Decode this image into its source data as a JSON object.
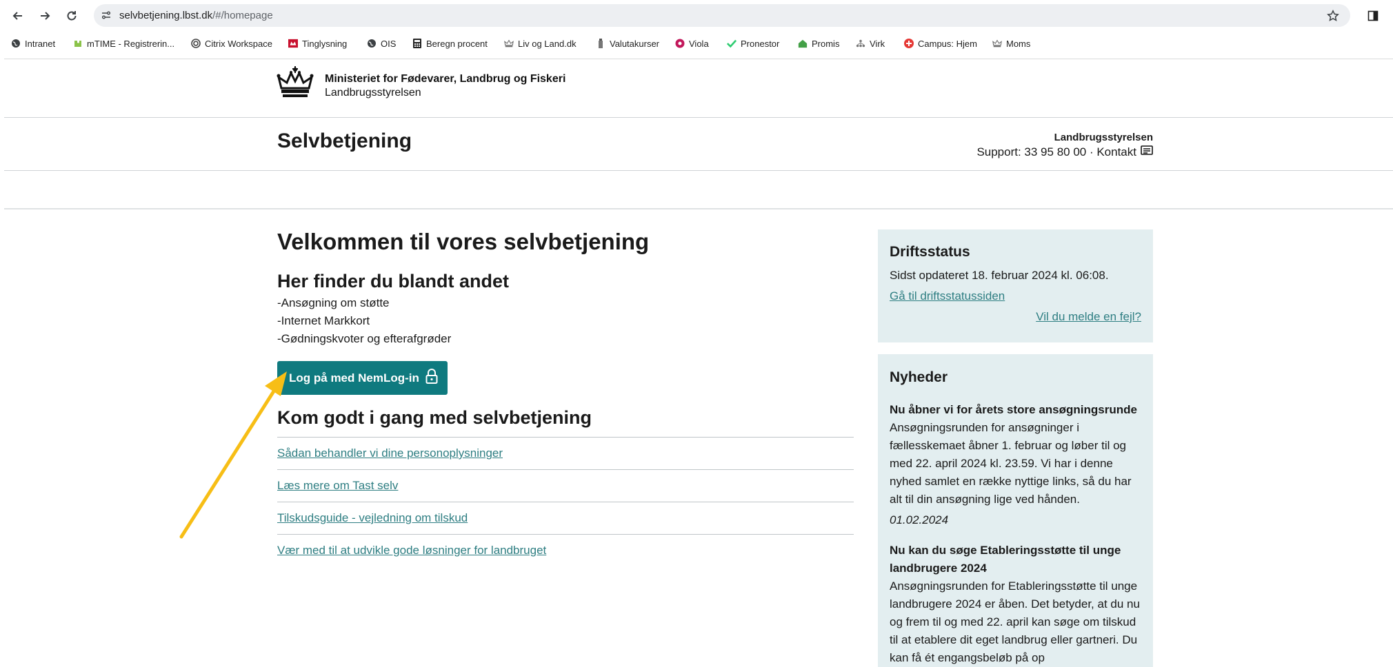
{
  "browser": {
    "url_host": "selvbetjening.lbst.dk",
    "url_path": "/#/homepage",
    "bookmarks": [
      {
        "label": "Intranet",
        "icon": "globe-icon"
      },
      {
        "label": "mTIME - Registrerin...",
        "icon": "puzzle-icon"
      },
      {
        "label": "Citrix Workspace",
        "icon": "citrix-icon"
      },
      {
        "label": "Tinglysning",
        "icon": "tinglysning-icon"
      },
      {
        "label": "OIS",
        "icon": "globe-icon"
      },
      {
        "label": "Beregn procent",
        "icon": "calculator-icon"
      },
      {
        "label": "Liv og Land.dk",
        "icon": "crown-icon"
      },
      {
        "label": "Valutakurser",
        "icon": "tower-icon"
      },
      {
        "label": "Viola",
        "icon": "viola-icon"
      },
      {
        "label": "Pronestor",
        "icon": "check-icon"
      },
      {
        "label": "Promis",
        "icon": "home-icon"
      },
      {
        "label": "Virk",
        "icon": "network-icon"
      },
      {
        "label": "Campus: Hjem",
        "icon": "plus-icon"
      },
      {
        "label": "Moms",
        "icon": "crown-icon"
      }
    ]
  },
  "header": {
    "ministry": "Ministeriet for Fødevarer, Landbrug og Fiskeri",
    "agency": "Landbrugsstyrelsen",
    "site_title": "Selvbetjening",
    "support_org": "Landbrugsstyrelsen",
    "support_text": "Support: 33 95 80 00 · Kontakt"
  },
  "main": {
    "welcome": "Velkommen til vores selvbetjening",
    "find_title": "Her finder du blandt andet",
    "find_items": [
      "-Ansøgning om støtte",
      "-Internet Markkort",
      "-Gødningskvoter og efterafgrøder"
    ],
    "login_label": "Log på med NemLog-in",
    "started_title": "Kom godt i gang med selvbetjening",
    "links": [
      "Sådan behandler vi dine personoplysninger",
      "Læs mere om Tast selv",
      "Tilskudsguide - vejledning om tilskud",
      "Vær med til at udvikle gode løsninger for landbruget"
    ]
  },
  "status": {
    "title": "Driftsstatus",
    "updated": "Sidst opdateret 18. februar 2024 kl. 06:08.",
    "link": "Gå til driftsstatussiden",
    "report": "Vil du melde en fejl?"
  },
  "news": {
    "title": "Nyheder",
    "items": [
      {
        "heading": "Nu åbner vi for årets store ansøgningsrunde",
        "body": "Ansøgningsrunden for ansøgninger i fællesskemaet åbner 1. februar og løber til og med 22. april 2024 kl. 23.59. Vi har i denne nyhed samlet en række nyttige links, så du har alt til din ansøgning lige ved hånden.",
        "date": "01.02.2024"
      },
      {
        "heading": "Nu kan du søge Etableringsstøtte til unge landbrugere 2024",
        "body": "Ansøgningsrunden for Etableringsstøtte til unge landbrugere 2024 er åben. Det betyder, at du nu og frem til og med 22. april kan søge om tilskud til at etablere dit eget landbrug eller gartneri. Du kan få ét engangsbeløb på op"
      }
    ]
  },
  "colors": {
    "primary": "#0f7a7f",
    "link": "#2e7e82",
    "panel": "#e3eef0",
    "arrow": "#f7be16"
  }
}
